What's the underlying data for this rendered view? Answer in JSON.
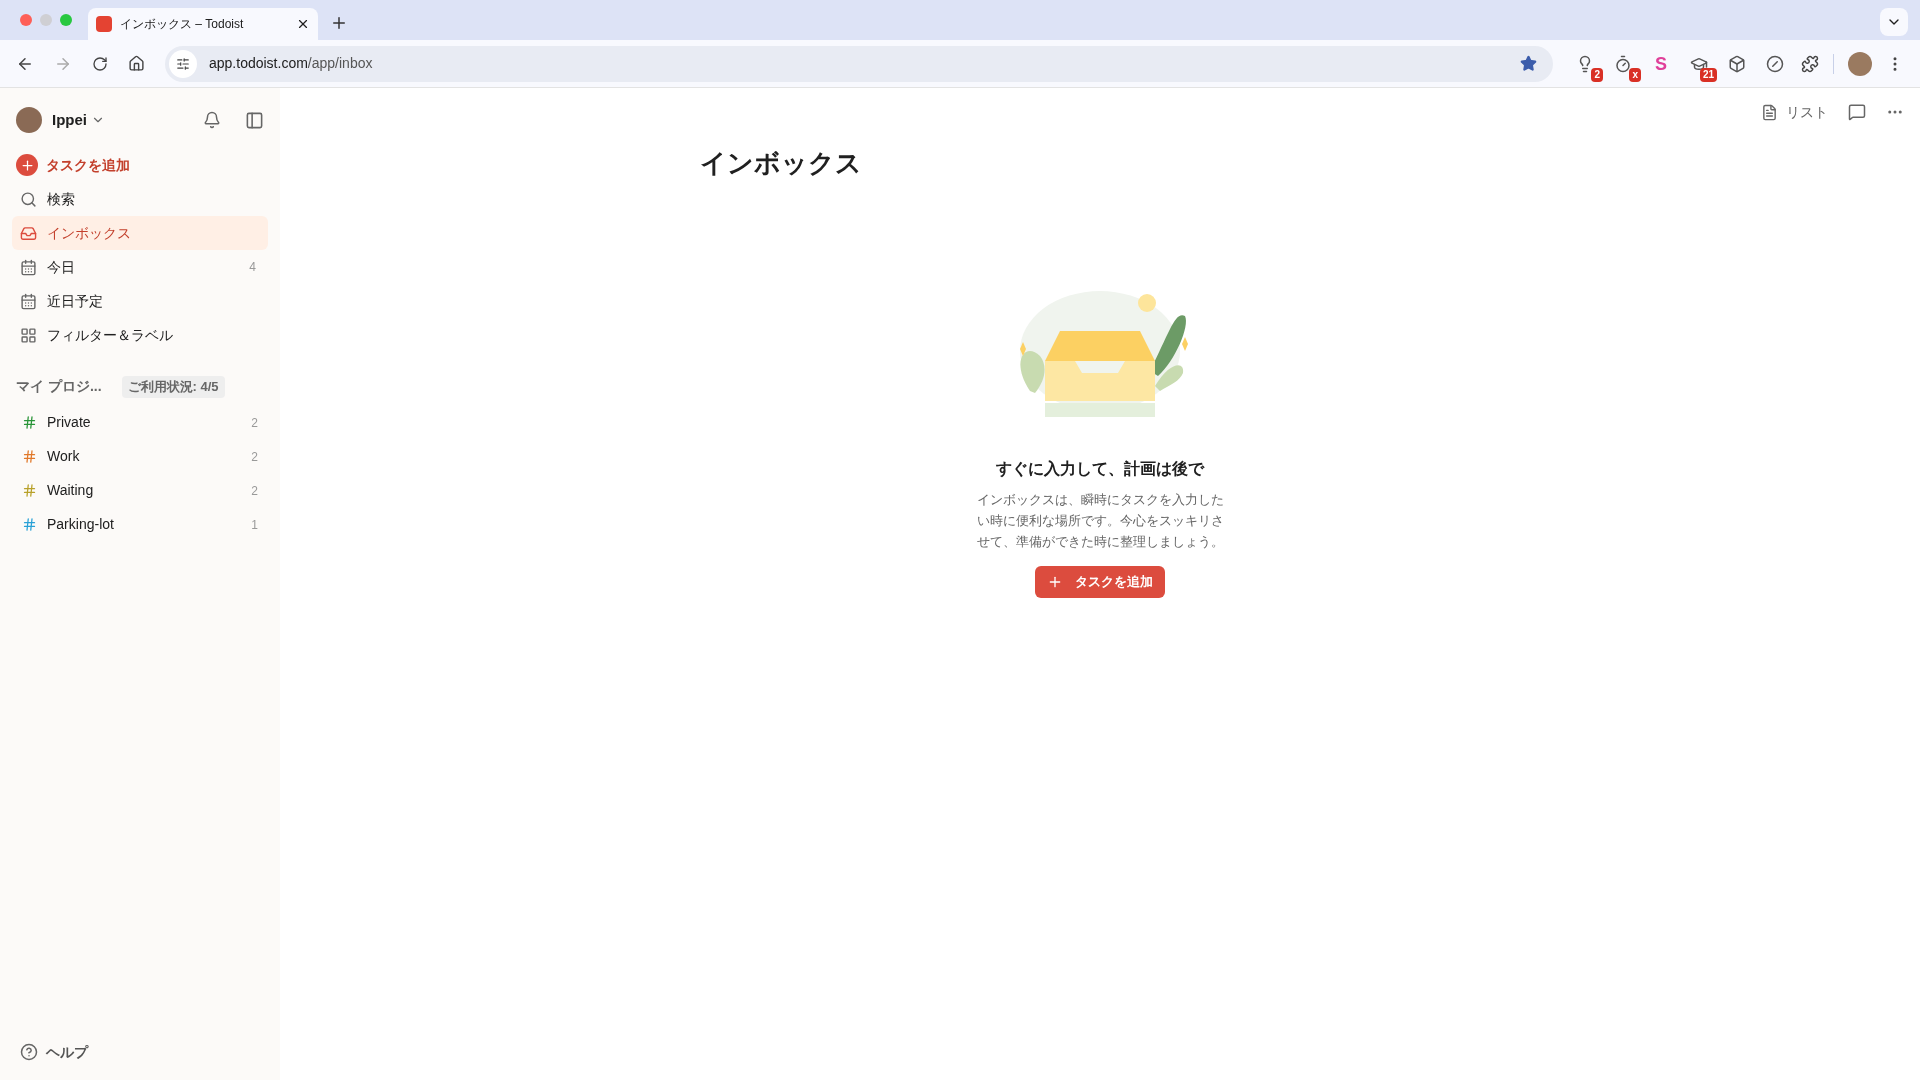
{
  "browser": {
    "tab": {
      "title": "インボックス – Todoist",
      "selected": true
    },
    "url_host": "app.todoist.com",
    "url_path": "/app/inbox",
    "extensions": [
      {
        "kind": "bulb",
        "badge": "2"
      },
      {
        "kind": "timer",
        "badge": "x"
      },
      {
        "kind": "letter",
        "letter": "S"
      },
      {
        "kind": "cap",
        "badge": "21"
      },
      {
        "kind": "cube"
      },
      {
        "kind": "blocker"
      }
    ]
  },
  "sidebar": {
    "user": "Ippei",
    "add_task": "タスクを追加",
    "nav": [
      {
        "kind": "search",
        "label": "検索",
        "selected": false
      },
      {
        "kind": "inbox",
        "label": "インボックス",
        "selected": true
      },
      {
        "kind": "today",
        "label": "今日",
        "count": "4",
        "selected": false
      },
      {
        "kind": "upcoming",
        "label": "近日予定",
        "selected": false
      },
      {
        "kind": "filters",
        "label": "フィルター＆ラベル",
        "selected": false
      }
    ],
    "projects_heading": "マイ プロジ...",
    "usage_badge": "ご利用状況: 4/5",
    "projects": [
      {
        "name": "Private",
        "count": "2",
        "color": "#299438"
      },
      {
        "name": "Work",
        "count": "2",
        "color": "#e0782a"
      },
      {
        "name": "Waiting",
        "count": "2",
        "color": "#b8a12a"
      },
      {
        "name": "Parking-lot",
        "count": "1",
        "color": "#2aa1d6"
      }
    ],
    "help": "ヘルプ"
  },
  "main": {
    "view_label": "リスト",
    "title": "インボックス",
    "empty_heading": "すぐに入力して、計画は後で",
    "empty_text": "インボックスは、瞬時にタスクを入力したい時に便利な場所です。今心をスッキリさせて、準備ができた時に整理しましょう。",
    "add_button": "タスクを追加"
  }
}
